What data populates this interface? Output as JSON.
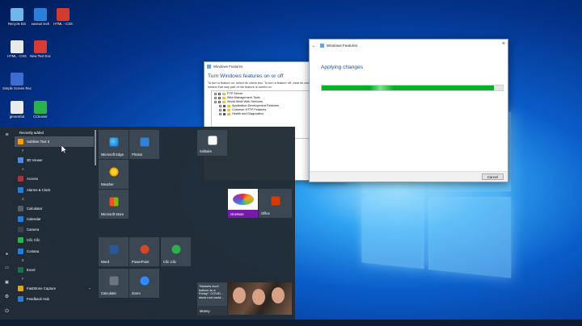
{
  "desktop": {
    "icons": [
      {
        "label": "Recycle Bin",
        "color": "#6fb6ea"
      },
      {
        "label": "easeus tech",
        "color": "#2c7fd8"
      },
      {
        "label": "HTML - CSS",
        "color": "#d43a2e"
      },
      {
        "label": "HTML - CSS",
        "color": "#e9e9e9"
      },
      {
        "label": "New Text Doc",
        "color": "#d83b34"
      },
      {
        "label": "Simple Screen Rec",
        "color": "#3c6cd0"
      },
      {
        "label": "greenshot",
        "color": "#eaeaea"
      },
      {
        "label": "CCleaner",
        "color": "#2bb24c"
      }
    ]
  },
  "windows_features": {
    "title": "Windows Features",
    "heading": "Turn Windows features on or off",
    "description": "To turn a feature on, select its check box. To turn a feature off, clear its check box. A filled box means that only part of the feature is turned on.",
    "tree": [
      "FTP Server",
      "Web Management Tools",
      "World Wide Web Services",
      "Application Development Features",
      "Common HTTP Features",
      "Health and Diagnostics"
    ],
    "side_text": "Core"
  },
  "applying": {
    "title": "Windows Features",
    "heading": "Applying changes",
    "progress_fraction": 0.95,
    "cancel_label": "Cancel"
  },
  "start_menu": {
    "recently_added_label": "Recently added",
    "apps": [
      {
        "type": "item",
        "label": "Sublime Text 3",
        "color": "#f39c12",
        "highlight": true
      },
      {
        "type": "letter",
        "label": "#"
      },
      {
        "type": "item",
        "label": "3D Viewer",
        "color": "#4c8ae0"
      },
      {
        "type": "letter",
        "label": "A"
      },
      {
        "type": "item",
        "label": "Access",
        "color": "#a4373a"
      },
      {
        "type": "item",
        "label": "Alarms & Clock",
        "color": "#2a7bd4"
      },
      {
        "type": "letter",
        "label": "C"
      },
      {
        "type": "item",
        "label": "Calculator",
        "color": "#555d66"
      },
      {
        "type": "item",
        "label": "Calendar",
        "color": "#2a7bd4"
      },
      {
        "type": "item",
        "label": "Camera",
        "color": "#3a424b"
      },
      {
        "type": "item",
        "label": "Cốc Cốc",
        "color": "#2bb24c"
      },
      {
        "type": "item",
        "label": "Cortana",
        "color": "#2a7bd4"
      },
      {
        "type": "letter",
        "label": "E"
      },
      {
        "type": "item",
        "label": "Excel",
        "color": "#1d7044"
      },
      {
        "type": "letter",
        "label": "F"
      },
      {
        "type": "item",
        "label": "FastStone Capture",
        "color": "#d9a52a",
        "chevron": true
      },
      {
        "type": "item",
        "label": "Feedback Hub",
        "color": "#2a7bd4"
      }
    ],
    "tiles": {
      "edge": "Microsoft Edge",
      "photos": "Photos",
      "weather": "Weather",
      "store": "Microsoft Store",
      "solitaire": "Solitaire",
      "news_headline": "\"Markets don't bottom on a Friday\": COVID... stock rout could...",
      "money": "Money",
      "onenote": "OneNote",
      "office": "Office",
      "word": "Word",
      "powerpoint": "PowerPoint",
      "coccoc": "Cốc Cốc",
      "calculator": "Calculator",
      "zoom": "Zoom"
    }
  }
}
